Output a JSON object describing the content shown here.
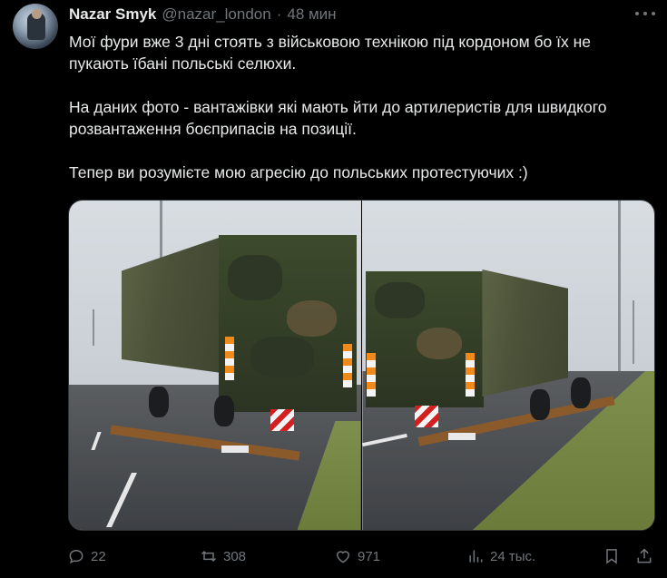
{
  "tweet": {
    "author_name": "Nazar Smyk",
    "handle": "@nazar_london",
    "separator": "·",
    "time": "48 мин",
    "text_lines": [
      "Мої фури вже 3 дні стоять з військовою технікою під кордоном бо  їх не",
      "пукають їбані польські селюхи.",
      "На даних фото - вантажівки які мають йти до артилеристів для швидкого",
      "розвантаження боєприпасів на позиції.",
      "Тепер ви розумієте мою агресію до польських протестуючих :)"
    ]
  },
  "media": {
    "icons": [
      "photo-left",
      "photo-right"
    ]
  },
  "actions": {
    "replies": "22",
    "reposts": "308",
    "likes": "971",
    "views": "24 тыс."
  },
  "icons": {
    "reply": "reply-icon",
    "repost": "repost-icon",
    "like": "heart-icon",
    "views": "views-icon",
    "bookmark": "bookmark-icon",
    "share": "share-icon",
    "more": "more-icon"
  },
  "colors": {
    "background": "#000000",
    "text": "#e7e9ea",
    "secondary": "#71767b"
  }
}
